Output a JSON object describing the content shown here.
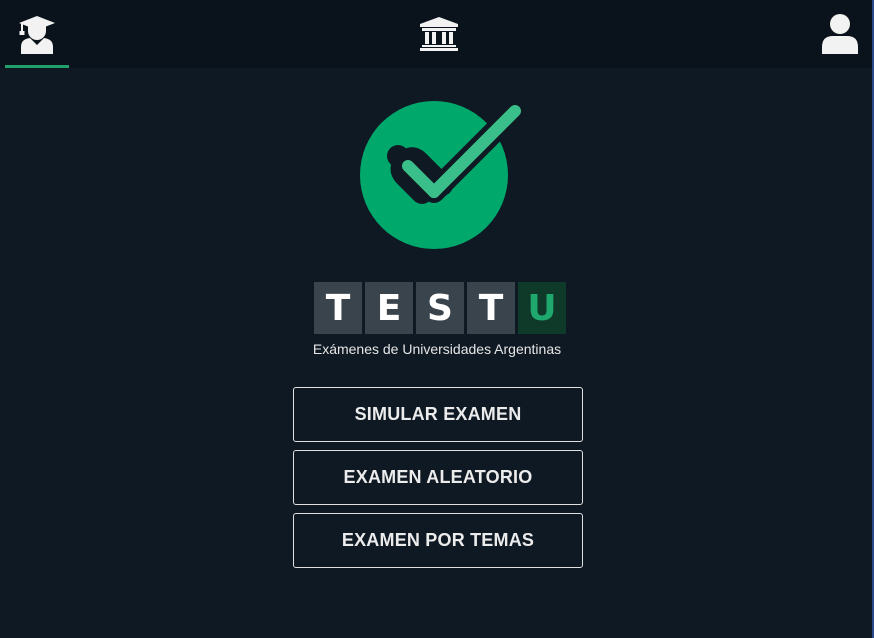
{
  "nav": {
    "tabs": [
      {
        "icon": "graduate-icon",
        "active": true
      },
      {
        "icon": "university-icon",
        "active": false
      },
      {
        "icon": "user-icon",
        "active": false
      }
    ],
    "active_color": "#22a06b"
  },
  "brand": {
    "letters": [
      "T",
      "E",
      "S",
      "T",
      "U"
    ],
    "tagline": "Exámenes de Universidades Argentinas",
    "logo_color": "#00a86b",
    "check_color": "#3bbf8a"
  },
  "actions": {
    "simulate_label": "SIMULAR EXAMEN",
    "random_label": "EXAMEN ALEATORIO",
    "topics_label": "EXAMEN POR TEMAS"
  }
}
